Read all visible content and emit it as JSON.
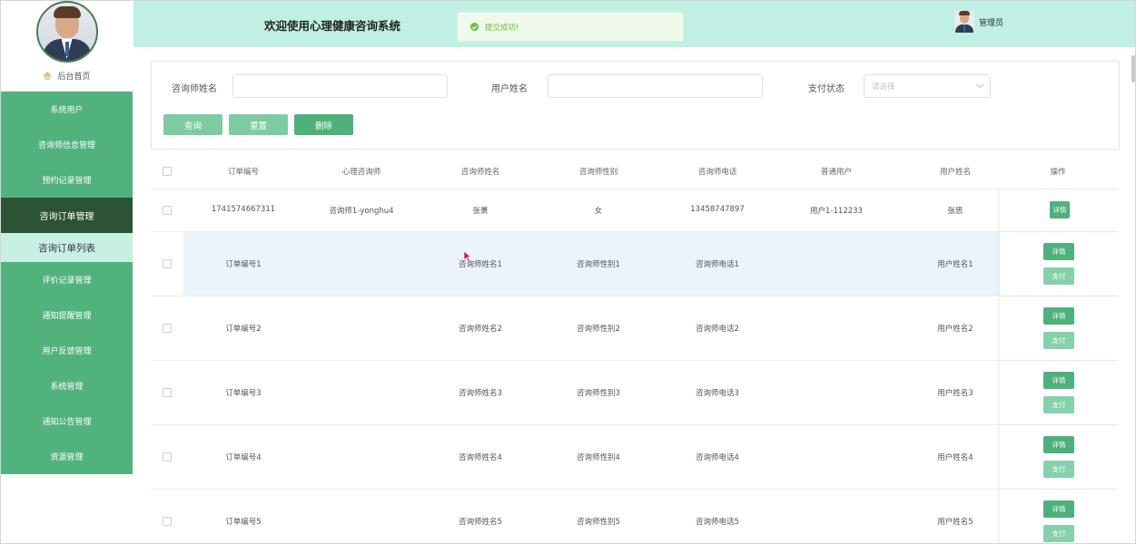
{
  "sidebar": {
    "home_label": "后台首页",
    "menu": [
      {
        "label": "系统用户"
      },
      {
        "label": "咨询师信息管理"
      },
      {
        "label": "预约记录管理"
      },
      {
        "label": "咨询订单管理"
      },
      {
        "label": "咨询订单列表"
      },
      {
        "label": "评价记录管理"
      },
      {
        "label": "通知提醒管理"
      },
      {
        "label": "用户反馈管理"
      },
      {
        "label": "系统管理"
      },
      {
        "label": "通知公告管理"
      },
      {
        "label": "资源管理"
      }
    ]
  },
  "header": {
    "title": "欢迎使用心理健康咨询系统",
    "toast": "提交成功!",
    "user": "管理员"
  },
  "search": {
    "label1": "咨询师姓名",
    "label2": "用户姓名",
    "label3": "支付状态",
    "select_placeholder": "请选择",
    "btn_query": "查询",
    "btn_reset": "重置",
    "btn_delete": "删除"
  },
  "table": {
    "headers": [
      "订单编号",
      "心理咨询师",
      "咨询师姓名",
      "咨询师性别",
      "咨询师电话",
      "普通用户",
      "用户姓名",
      "操作"
    ],
    "detail_label": "详情",
    "pay_label": "支付",
    "rows": [
      [
        "1741574667311",
        "咨询师1-yonghu4",
        "张裹",
        "女",
        "13458747897",
        "用户1-112233",
        "张思"
      ],
      [
        "订单编号1",
        "",
        "咨询师姓名1",
        "咨询师性别1",
        "咨询师电话1",
        "",
        "用户姓名1"
      ],
      [
        "订单编号2",
        "",
        "咨询师姓名2",
        "咨询师性别2",
        "咨询师电话2",
        "",
        "用户姓名2"
      ],
      [
        "订单编号3",
        "",
        "咨询师姓名3",
        "咨询师性别3",
        "咨询师电话3",
        "",
        "用户姓名3"
      ],
      [
        "订单编号4",
        "",
        "咨询师姓名4",
        "咨询师性别4",
        "咨询师电话4",
        "",
        "用户姓名4"
      ],
      [
        "订单编号5",
        "",
        "咨询师姓名5",
        "咨询师性别5",
        "咨询师电话5",
        "",
        "用户姓名5"
      ]
    ]
  }
}
